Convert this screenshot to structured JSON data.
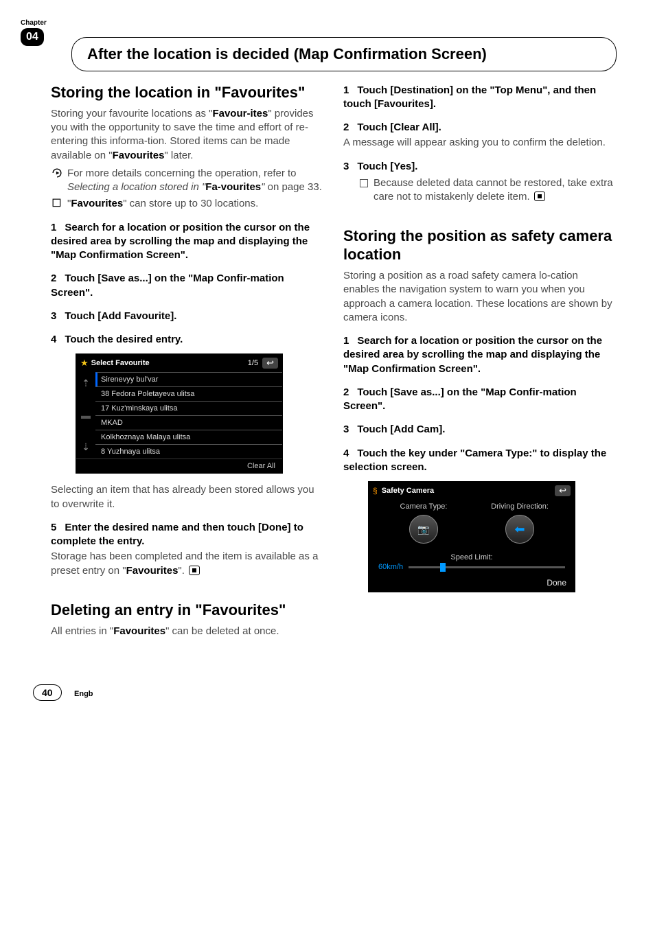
{
  "chapter": {
    "label": "Chapter",
    "number": "04"
  },
  "header_title": "After the location is decided (Map Confirmation Screen)",
  "left": {
    "h_store": "Storing the location in \"Favourites\"",
    "p_store": [
      "Storing your favourite locations as \"",
      "Favour-ites",
      "\" provides you with the opportunity to save the time and effort of re-entering this informa-tion. Stored items can be made available on \"",
      "Favourites",
      "\" later."
    ],
    "bullet1_pre": "For more details concerning the operation, refer to ",
    "bullet1_italic": "Selecting a location stored in \"",
    "bullet1_bold": "Fa-vourites",
    "bullet1_italic2": "\"",
    "bullet1_post": " on page 33.",
    "bullet2_pre": "\"",
    "bullet2_bold": "Favourites",
    "bullet2_post": "\" can store up to 30 locations.",
    "step1": "Search for a location or position the cursor on the desired area by scrolling the map and displaying the \"Map Confirmation Screen\".",
    "step2": "Touch [Save as...] on the \"Map Confir-mation Screen\".",
    "step3": "Touch [Add Favourite].",
    "step4": "Touch the desired entry.",
    "fig1": {
      "title": "Select Favourite",
      "page": "1/5",
      "rows": [
        "Sirenevyy bul'var",
        "38 Fedora Poletayeva ulitsa",
        "17 Kuz'minskaya ulitsa",
        "MKAD",
        "Kolkhoznaya Malaya ulitsa",
        "8 Yuzhnaya ulitsa"
      ],
      "clear": "Clear All"
    },
    "p_select": "Selecting an item that has already been stored allows you to overwrite it.",
    "step5": "Enter the desired name and then touch [Done] to complete the entry.",
    "p_storage1": "Storage has been completed and the item is available as a preset entry on \"",
    "p_storage_bold": "Favourites",
    "p_storage2": "\".",
    "h_delete": "Deleting an entry in \"Favourites\"",
    "p_delete1": "All entries in \"",
    "p_delete_bold": "Favourites",
    "p_delete2": "\" can be deleted at once."
  },
  "right": {
    "step1": "Touch [Destination] on the \"Top Menu\", and then touch [Favourites].",
    "step2": "Touch [Clear All].",
    "p_msg": "A message will appear asking you to confirm the deletion.",
    "step3": "Touch [Yes].",
    "note": "Because deleted data cannot be restored, take extra care not to mistakenly delete item.",
    "h_cam": "Storing the position as safety camera location",
    "p_cam": "Storing a position as a road safety camera lo-cation enables the navigation system to warn you when you approach a camera location. These locations are shown by camera icons.",
    "cstep1": "Search for a location or position the cursor on the desired area by scrolling the map and displaying the \"Map Confirmation Screen\".",
    "cstep2": "Touch [Save as...] on the \"Map Confir-mation Screen\".",
    "cstep3": "Touch [Add Cam].",
    "cstep4": "Touch the key under \"Camera Type:\" to display the selection screen.",
    "fig2": {
      "title": "Safety Camera",
      "type_label": "Camera Type:",
      "dir_label": "Driving Direction:",
      "speed_label": "Speed Limit:",
      "speed_value": "60km/h",
      "done": "Done"
    }
  },
  "footer": {
    "page": "40",
    "lang": "Engb"
  }
}
